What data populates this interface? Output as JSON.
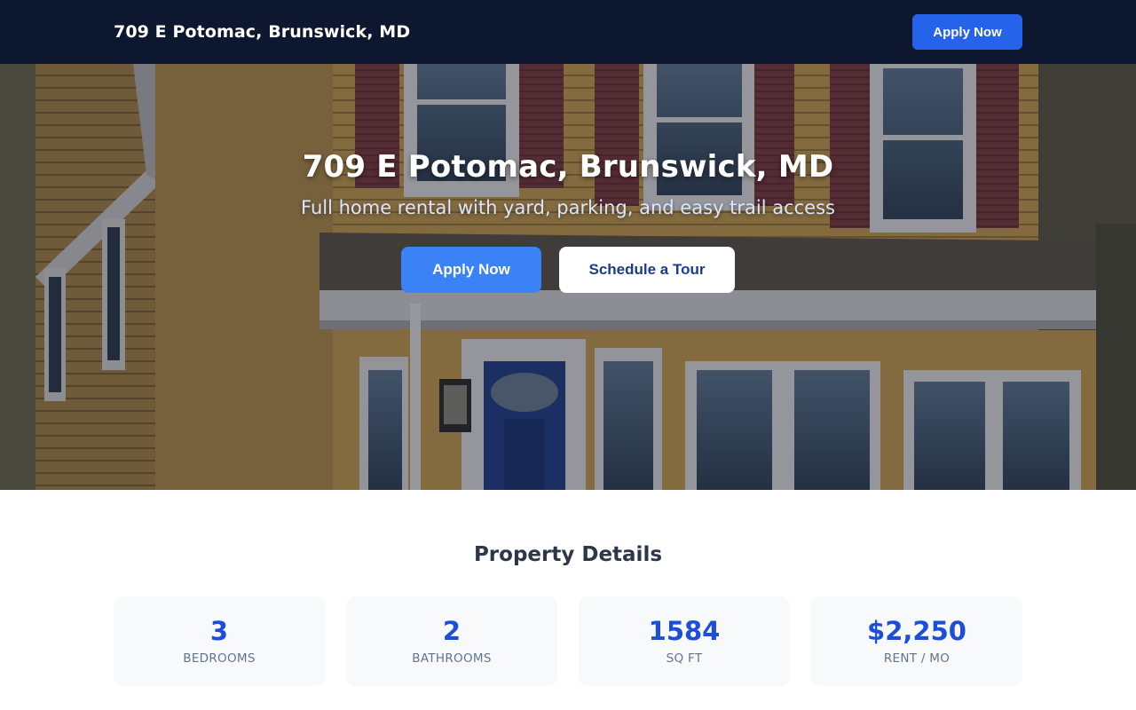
{
  "nav": {
    "title": "709 E Potomac, Brunswick, MD",
    "apply_label": "Apply Now"
  },
  "hero": {
    "title": "709 E Potomac, Brunswick, MD",
    "subtitle": "Full home rental with yard, parking, and easy trail access",
    "apply_label": "Apply Now",
    "tour_label": "Schedule a Tour"
  },
  "details": {
    "title": "Property Details",
    "stats": [
      {
        "value": "3",
        "label": "BEDROOMS"
      },
      {
        "value": "2",
        "label": "BATHROOMS"
      },
      {
        "value": "1584",
        "label": "SQ FT"
      },
      {
        "value": "$2,250",
        "label": "RENT / MO"
      }
    ]
  },
  "colors": {
    "nav_bg": "#0d1730",
    "primary": "#2563eb",
    "primary_light": "#3b82f6",
    "stat_value": "#1d4ed8",
    "card_bg": "#f7f9fb"
  }
}
